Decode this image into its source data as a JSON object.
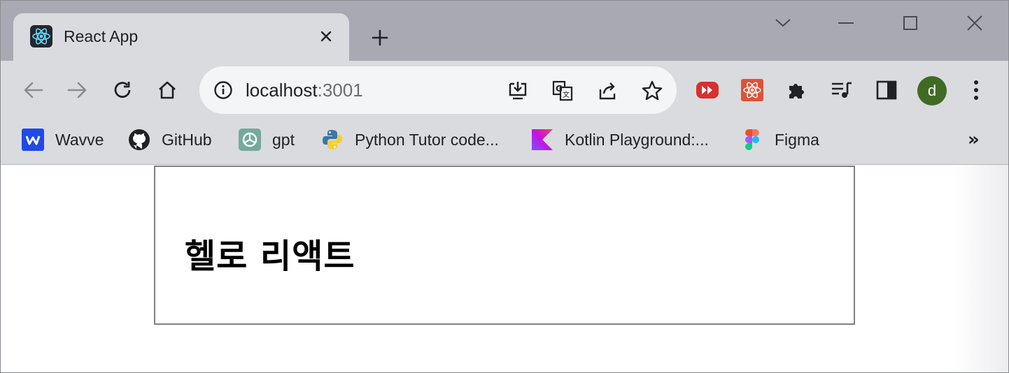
{
  "tab": {
    "title": "React App"
  },
  "address_bar": {
    "host": "localhost",
    "port": ":3001"
  },
  "profile": {
    "initial": "d"
  },
  "bookmarks": [
    {
      "label": "Wavve"
    },
    {
      "label": "GitHub"
    },
    {
      "label": "gpt"
    },
    {
      "label": "Python Tutor code..."
    },
    {
      "label": "Kotlin Playground:..."
    },
    {
      "label": "Figma"
    }
  ],
  "bookmarks_overflow": "»",
  "page": {
    "heading": "헬로 리액트"
  },
  "colors": {
    "tabstrip": "#a8a9b2",
    "toolbar": "#dadbde",
    "omnibox": "#f4f5f7",
    "avatar": "#3f6b25"
  }
}
